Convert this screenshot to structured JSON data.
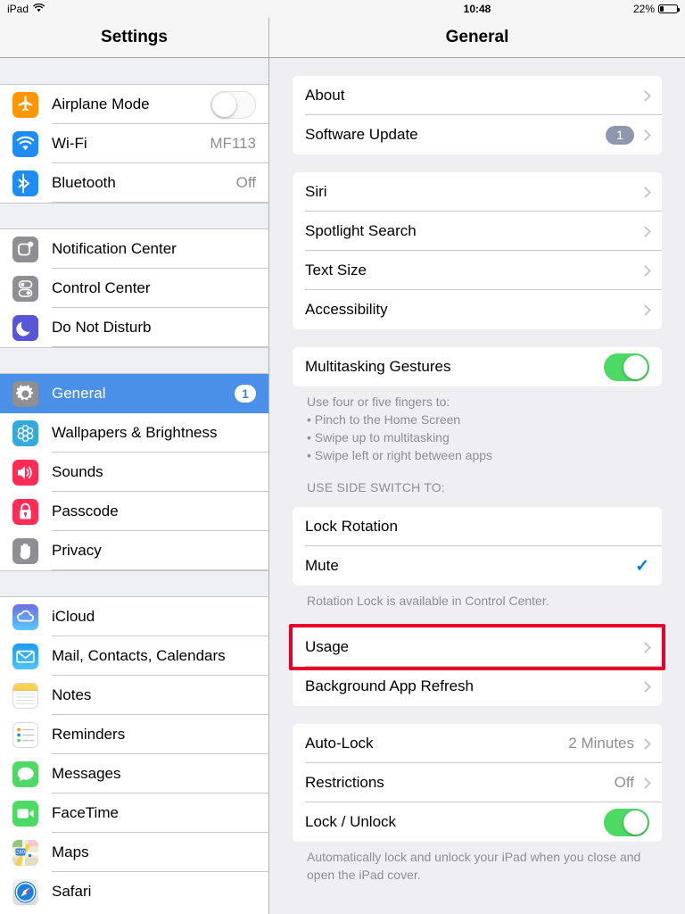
{
  "statusbar": {
    "device": "iPad",
    "wifi_icon": "wifi-icon",
    "time": "10:48",
    "battery_percent": "22%",
    "battery_level": 22
  },
  "sidebar": {
    "title": "Settings",
    "sections": [
      {
        "items": [
          {
            "label": "Airplane Mode",
            "icon": "airplane-icon",
            "icon_class": "ic-plane",
            "control": "toggle",
            "toggle_on": false
          },
          {
            "label": "Wi-Fi",
            "icon": "wifi-icon",
            "icon_class": "ic-wifi",
            "control": "value",
            "value": "MF113"
          },
          {
            "label": "Bluetooth",
            "icon": "bluetooth-icon",
            "icon_class": "ic-bt",
            "control": "value",
            "value": "Off"
          }
        ]
      },
      {
        "items": [
          {
            "label": "Notification Center",
            "icon": "notification-center-icon",
            "icon_class": "ic-gray",
            "control": "none"
          },
          {
            "label": "Control Center",
            "icon": "control-center-icon",
            "icon_class": "ic-gray",
            "control": "none"
          },
          {
            "label": "Do Not Disturb",
            "icon": "moon-icon",
            "icon_class": "ic-purple",
            "control": "none"
          }
        ]
      },
      {
        "items": [
          {
            "label": "General",
            "icon": "gear-icon",
            "icon_class": "ic-gray",
            "control": "badge",
            "badge": "1",
            "selected": true
          },
          {
            "label": "Wallpapers & Brightness",
            "icon": "wallpaper-icon",
            "icon_class": "ic-cyan",
            "control": "none"
          },
          {
            "label": "Sounds",
            "icon": "speaker-icon",
            "icon_class": "ic-red",
            "control": "none"
          },
          {
            "label": "Passcode",
            "icon": "lock-icon",
            "icon_class": "ic-red",
            "control": "none"
          },
          {
            "label": "Privacy",
            "icon": "hand-icon",
            "icon_class": "ic-gray",
            "control": "none"
          }
        ]
      },
      {
        "items": [
          {
            "label": "iCloud",
            "icon": "cloud-icon",
            "icon_class": "ic-icloud",
            "control": "none"
          },
          {
            "label": "Mail, Contacts, Calendars",
            "icon": "envelope-icon",
            "icon_class": "ic-mail",
            "control": "none"
          },
          {
            "label": "Notes",
            "icon": "notes-icon",
            "icon_class": "ic-notes",
            "control": "none"
          },
          {
            "label": "Reminders",
            "icon": "reminders-icon",
            "icon_class": "ic-rem",
            "control": "none"
          },
          {
            "label": "Messages",
            "icon": "message-bubble-icon",
            "icon_class": "ic-green",
            "control": "none"
          },
          {
            "label": "FaceTime",
            "icon": "video-camera-icon",
            "icon_class": "ic-green",
            "control": "none"
          },
          {
            "label": "Maps",
            "icon": "maps-icon",
            "icon_class": "ic-maps",
            "control": "none"
          },
          {
            "label": "Safari",
            "icon": "compass-icon",
            "icon_class": "ic-safari",
            "control": "none"
          }
        ]
      }
    ]
  },
  "detail": {
    "title": "General",
    "groups": [
      {
        "rows": [
          {
            "label": "About",
            "control": "chevron"
          },
          {
            "label": "Software Update",
            "control": "badge-chevron",
            "badge": "1"
          }
        ]
      },
      {
        "rows": [
          {
            "label": "Siri",
            "control": "chevron"
          },
          {
            "label": "Spotlight Search",
            "control": "chevron"
          },
          {
            "label": "Text Size",
            "control": "chevron"
          },
          {
            "label": "Accessibility",
            "control": "chevron"
          }
        ]
      },
      {
        "rows": [
          {
            "label": "Multitasking Gestures",
            "control": "toggle",
            "toggle_on": true
          }
        ],
        "footer": "Use four or five fingers to:\n• Pinch to the Home Screen\n• Swipe up to multitasking\n• Swipe left or right between apps"
      },
      {
        "header": "USE SIDE SWITCH TO:",
        "rows": [
          {
            "label": "Lock Rotation",
            "control": "none"
          },
          {
            "label": "Mute",
            "control": "check"
          }
        ],
        "footer": "Rotation Lock is available in Control Center."
      },
      {
        "rows": [
          {
            "label": "Usage",
            "control": "chevron",
            "highlighted": true
          },
          {
            "label": "Background App Refresh",
            "control": "chevron"
          }
        ]
      },
      {
        "rows": [
          {
            "label": "Auto-Lock",
            "control": "value-chevron",
            "value": "2 Minutes"
          },
          {
            "label": "Restrictions",
            "control": "value-chevron",
            "value": "Off"
          },
          {
            "label": "Lock / Unlock",
            "control": "toggle",
            "toggle_on": true
          }
        ],
        "footer": "Automatically lock and unlock your iPad when you close and open the iPad cover."
      }
    ]
  },
  "annotation": {
    "target": "Usage",
    "color": "#e8002a"
  },
  "colors": {
    "selection_blue": "#4a90e8",
    "toggle_on_green": "#4cd964",
    "check_blue": "#007aff",
    "badge_gray_blue": "#8e97ad",
    "secondary_text": "#8e8e93",
    "background": "#eeeef3",
    "navbar": "#f5f5f5"
  }
}
